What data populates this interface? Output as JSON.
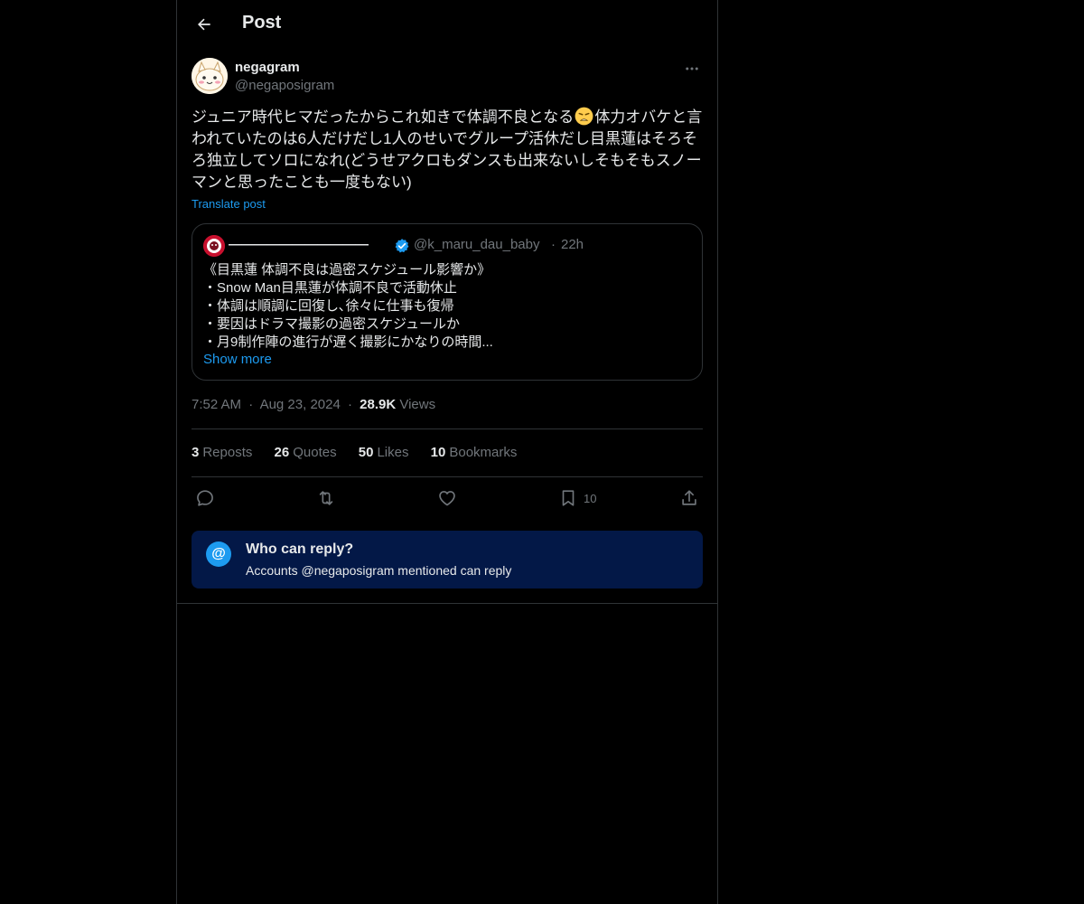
{
  "header": {
    "title": "Post",
    "back_icon": "arrow-left-icon"
  },
  "author": {
    "display_name": "negagram",
    "handle": "@negaposigram",
    "avatar_icon": "cartoon-face-avatar",
    "more_icon": "ellipsis-icon"
  },
  "post": {
    "text_before_emoji": "ジュニア時代ヒマだったからこれ如きで体調不良となる",
    "emoji_icon": "weary-face-emoji",
    "text_after_emoji": "体力オバケと言われていたのは6人だけだし1人のせいでグループ活休だし目黒蓮はそろそろ独立してソロになれ(どうせアクロもダンスも出来ないしそもそもスノーマンと思ったことも一度もない)",
    "translate_label": "Translate post"
  },
  "quote": {
    "name": "———————————",
    "verified_icon": "verified-badge-icon",
    "handle": "@k_maru_dau_baby",
    "separator": "·",
    "time": "22h",
    "lines": [
      "《目黒蓮 体調不良は過密スケジュール影響か》",
      "・Snow Man目黒蓮が体調不良で活動休止",
      "・体調は順調に回復し､徐々に仕事も復帰",
      "・要因はドラマ撮影の過密スケジュールか",
      "・月9制作陣の進行が遅く撮影にかなりの時間..."
    ],
    "show_more": "Show more"
  },
  "meta": {
    "time": "7:52 AM",
    "date": "Aug 23, 2024",
    "separator": "·",
    "views_count": "28.9K",
    "views_label": "Views"
  },
  "stats": [
    {
      "count": "3",
      "label": "Reposts"
    },
    {
      "count": "26",
      "label": "Quotes"
    },
    {
      "count": "50",
      "label": "Likes"
    },
    {
      "count": "10",
      "label": "Bookmarks"
    }
  ],
  "actions": {
    "reply_icon": "reply-icon",
    "repost_icon": "repost-icon",
    "like_icon": "heart-icon",
    "bookmark_icon": "bookmark-icon",
    "bookmark_count": "10",
    "share_icon": "share-icon"
  },
  "who_can_reply": {
    "icon_symbol": "@",
    "title": "Who can reply?",
    "description": "Accounts @negaposigram mentioned can reply"
  },
  "colors": {
    "background": "#000000",
    "text_primary": "#e7e9ea",
    "text_secondary": "#71767b",
    "accent": "#1d9bf0",
    "border": "#2f3336",
    "reply_box_bg": "#031847"
  }
}
